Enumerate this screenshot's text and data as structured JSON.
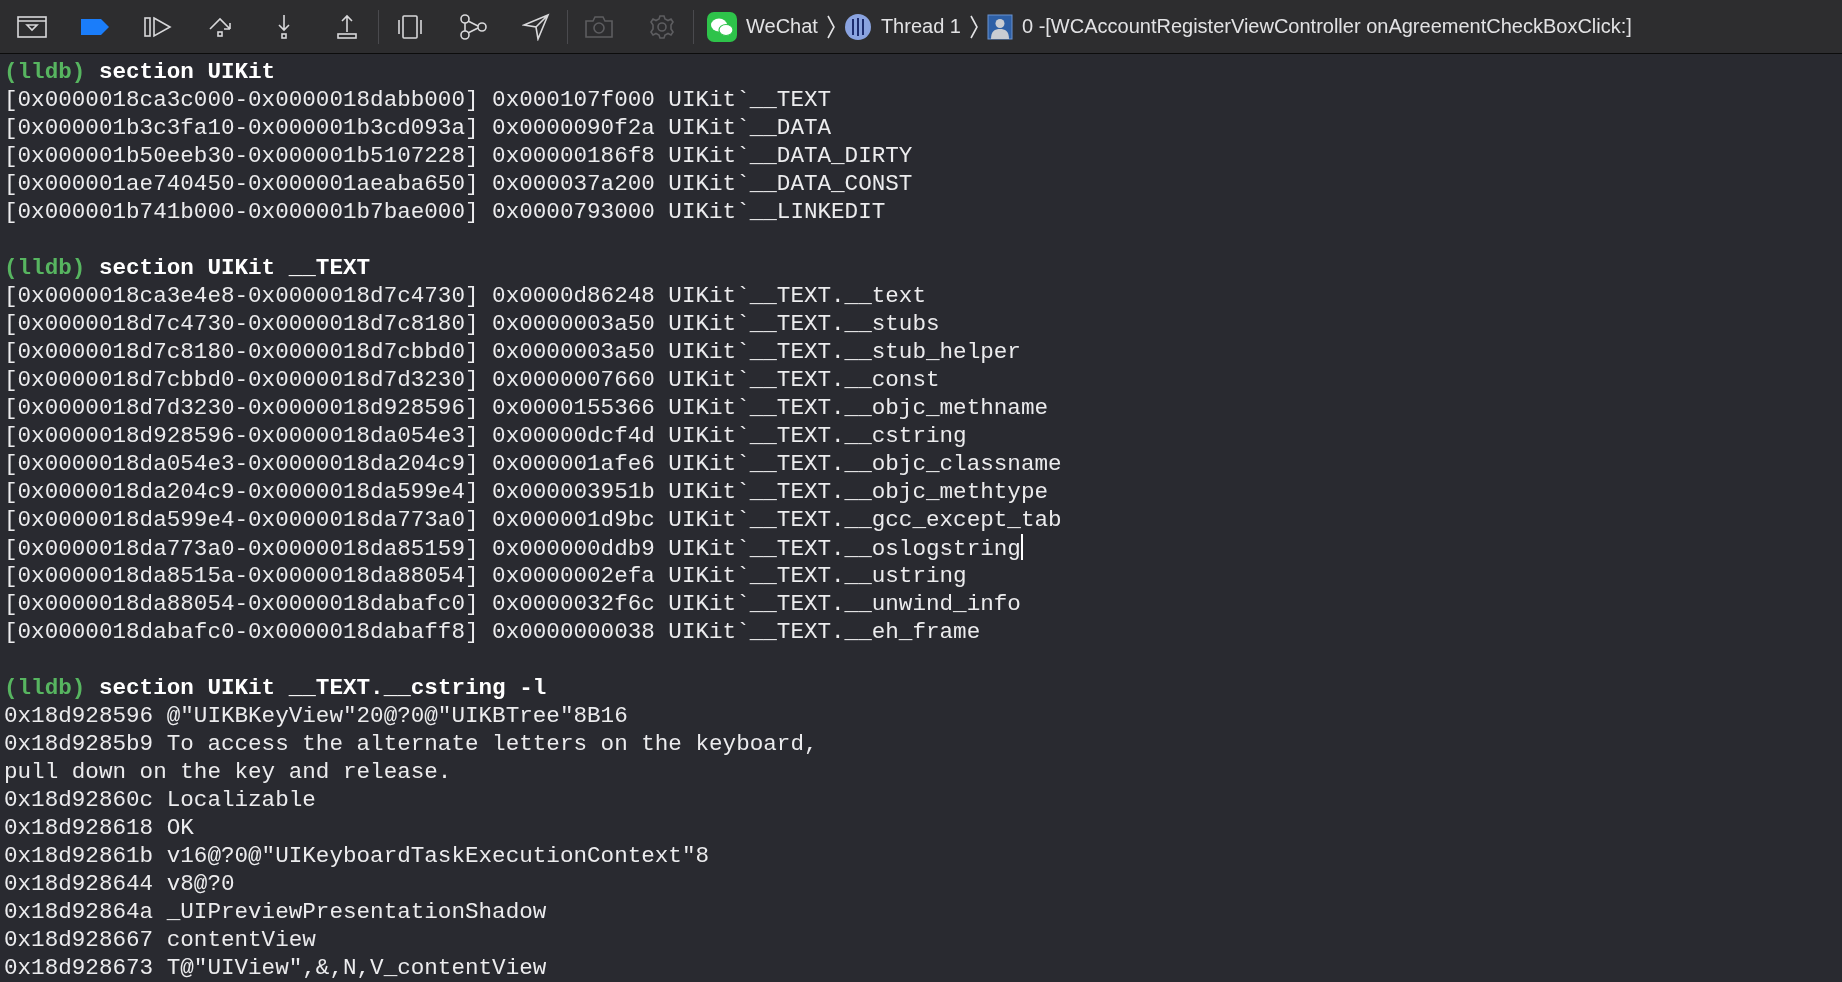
{
  "toolbar": {
    "buttons": [
      {
        "kind": "hide-console",
        "on": false,
        "disabled": false
      },
      {
        "kind": "breakpoints",
        "on": true,
        "disabled": false
      },
      {
        "kind": "continue",
        "on": false,
        "disabled": false
      },
      {
        "kind": "step-over",
        "on": false,
        "disabled": false
      },
      {
        "kind": "step-into",
        "on": false,
        "disabled": false
      },
      {
        "kind": "step-out",
        "on": false,
        "disabled": false
      },
      {
        "kind": "view-debugger",
        "on": false,
        "disabled": false
      },
      {
        "kind": "memory-graph",
        "on": false,
        "disabled": false
      },
      {
        "kind": "location",
        "on": false,
        "disabled": false
      },
      {
        "kind": "camera",
        "on": false,
        "disabled": true
      },
      {
        "kind": "environment",
        "on": false,
        "disabled": true
      }
    ],
    "breadcrumb": [
      {
        "kind": "app",
        "label": "WeChat"
      },
      {
        "kind": "thread",
        "label": "Thread 1"
      },
      {
        "kind": "frame",
        "label": "0 -[WCAccountRegisterViewController onAgreementCheckBoxClick:]"
      }
    ]
  },
  "console": {
    "blocks": [
      {
        "prompt": "(lldb)",
        "command": "section UIKit",
        "output": [
          {
            "text": "[0x0000018ca3c000-0x0000018dabb000] 0x000107f000 UIKit`__TEXT",
            "caret": false
          },
          {
            "text": "[0x000001b3c3fa10-0x000001b3cd093a] 0x0000090f2a UIKit`__DATA",
            "caret": false
          },
          {
            "text": "[0x000001b50eeb30-0x000001b5107228] 0x00000186f8 UIKit`__DATA_DIRTY",
            "caret": false
          },
          {
            "text": "[0x000001ae740450-0x000001aeaba650] 0x000037a200 UIKit`__DATA_CONST",
            "caret": false
          },
          {
            "text": "[0x000001b741b000-0x000001b7bae000] 0x0000793000 UIKit`__LINKEDIT",
            "caret": false
          }
        ]
      },
      {
        "prompt": "(lldb)",
        "command": "section UIKit __TEXT",
        "output": [
          {
            "text": "[0x0000018ca3e4e8-0x0000018d7c4730] 0x0000d86248 UIKit`__TEXT.__text",
            "caret": false
          },
          {
            "text": "[0x0000018d7c4730-0x0000018d7c8180] 0x0000003a50 UIKit`__TEXT.__stubs",
            "caret": false
          },
          {
            "text": "[0x0000018d7c8180-0x0000018d7cbbd0] 0x0000003a50 UIKit`__TEXT.__stub_helper",
            "caret": false
          },
          {
            "text": "[0x0000018d7cbbd0-0x0000018d7d3230] 0x0000007660 UIKit`__TEXT.__const",
            "caret": false
          },
          {
            "text": "[0x0000018d7d3230-0x0000018d928596] 0x0000155366 UIKit`__TEXT.__objc_methname",
            "caret": false
          },
          {
            "text": "[0x0000018d928596-0x0000018da054e3] 0x00000dcf4d UIKit`__TEXT.__cstring",
            "caret": false
          },
          {
            "text": "[0x0000018da054e3-0x0000018da204c9] 0x000001afe6 UIKit`__TEXT.__objc_classname",
            "caret": false
          },
          {
            "text": "[0x0000018da204c9-0x0000018da599e4] 0x000003951b UIKit`__TEXT.__objc_methtype",
            "caret": false
          },
          {
            "text": "[0x0000018da599e4-0x0000018da773a0] 0x000001d9bc UIKit`__TEXT.__gcc_except_tab",
            "caret": false
          },
          {
            "text": "[0x0000018da773a0-0x0000018da85159] 0x000000ddb9 UIKit`__TEXT.__oslogstring",
            "caret": true
          },
          {
            "text": "[0x0000018da8515a-0x0000018da88054] 0x0000002efa UIKit`__TEXT.__ustring",
            "caret": false
          },
          {
            "text": "[0x0000018da88054-0x0000018dabafc0] 0x0000032f6c UIKit`__TEXT.__unwind_info",
            "caret": false
          },
          {
            "text": "[0x0000018dabafc0-0x0000018dabaff8] 0x0000000038 UIKit`__TEXT.__eh_frame",
            "caret": false
          }
        ]
      },
      {
        "prompt": "(lldb)",
        "command": "section UIKit __TEXT.__cstring -l",
        "output": [
          {
            "text": "0x18d928596 @\"UIKBKeyView\"20@?0@\"UIKBTree\"8B16",
            "caret": false
          },
          {
            "text": "0x18d9285b9 To access the alternate letters on the keyboard,",
            "caret": false
          },
          {
            "text": "pull down on the key and release.",
            "caret": false
          },
          {
            "text": "0x18d92860c Localizable",
            "caret": false
          },
          {
            "text": "0x18d928618 OK",
            "caret": false
          },
          {
            "text": "0x18d92861b v16@?0@\"UIKeyboardTaskExecutionContext\"8",
            "caret": false
          },
          {
            "text": "0x18d928644 v8@?0",
            "caret": false
          },
          {
            "text": "0x18d92864a _UIPreviewPresentationShadow",
            "caret": false
          },
          {
            "text": "0x18d928667 contentView",
            "caret": false
          },
          {
            "text": "0x18d928673 T@\"UIView\",&,N,V_contentView",
            "caret": false
          }
        ]
      }
    ]
  }
}
